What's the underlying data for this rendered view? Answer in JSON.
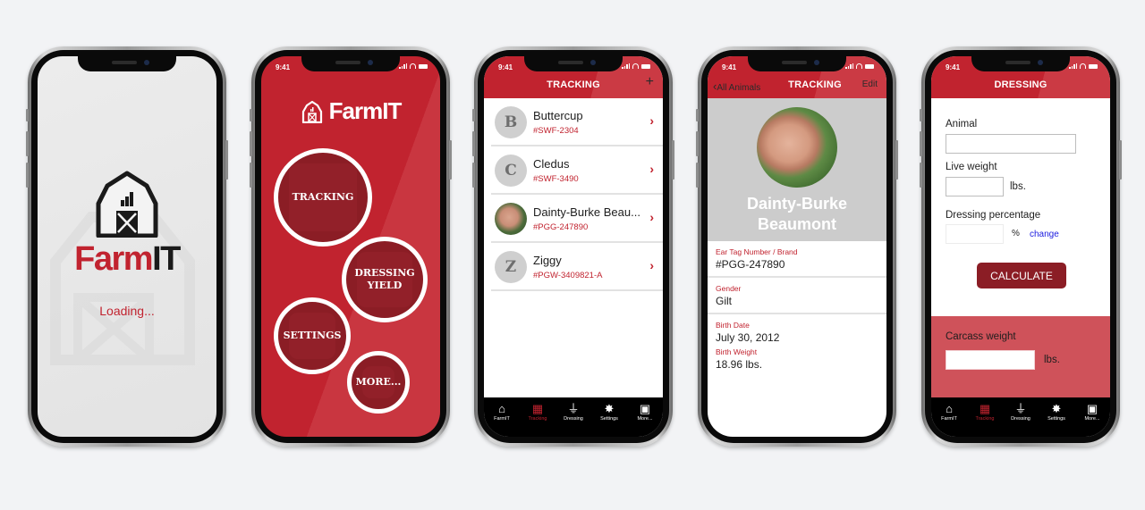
{
  "status_bar": {
    "time": "9:41"
  },
  "colors": {
    "brand_red": "#c1232f",
    "dark_red": "#8b1d25",
    "result_bg": "#cf525a",
    "link_blue": "#1a1adf"
  },
  "splash": {
    "logo": {
      "farm": "Farm",
      "it": "IT"
    },
    "loading_text": "Loading..."
  },
  "home": {
    "logo": {
      "farm": "Farm",
      "it": "IT"
    },
    "buttons": [
      {
        "label": "TRACKING",
        "icon": "notepad-icon"
      },
      {
        "label": "DRESSING YIELD",
        "icon": "scale-icon"
      },
      {
        "label": "SETTINGS",
        "icon": "gear-icon"
      },
      {
        "label": "MORE...",
        "icon": "grid-icon"
      }
    ]
  },
  "tracking_list": {
    "title": "TRACKING",
    "add_icon": "+",
    "animals": [
      {
        "initial": "B",
        "name": "Buttercup",
        "tag": "#SWF-2304",
        "photo": false
      },
      {
        "initial": "C",
        "name": "Cledus",
        "tag": "#SWF-3490",
        "photo": false
      },
      {
        "initial": "",
        "name": "Dainty-Burke Beau...",
        "tag": "#PGG-247890",
        "photo": true
      },
      {
        "initial": "Z",
        "name": "Ziggy",
        "tag": "#PGW-3409821-A",
        "photo": false
      }
    ]
  },
  "tabbar": {
    "items": [
      {
        "label": "FarmIT",
        "icon": "barn-icon",
        "glyph": "⌂"
      },
      {
        "label": "Tracking",
        "icon": "notepad-icon",
        "glyph": "▦"
      },
      {
        "label": "Dressing",
        "icon": "scale-icon",
        "glyph": "⏚"
      },
      {
        "label": "Settings",
        "icon": "gear-icon",
        "glyph": "✸"
      },
      {
        "label": "More...",
        "icon": "grid-icon",
        "glyph": "▣"
      }
    ],
    "active": "Tracking"
  },
  "animal_detail": {
    "back_label": "All Animals",
    "title": "TRACKING",
    "edit_label": "Edit",
    "name_line1": "Dainty-Burke",
    "name_line2": "Beaumont",
    "fields": [
      {
        "label": "Ear Tag Number / Brand",
        "value": "#PGG-247890"
      },
      {
        "label": "Gender",
        "value": "Gilt"
      },
      {
        "label": "Birth Date",
        "value": "July 30, 2012"
      },
      {
        "label": "Birth  Weight",
        "value": "18.96 lbs."
      }
    ]
  },
  "dressing": {
    "title": "DRESSING",
    "animal_label": "Animal",
    "animal_value": "",
    "live_weight_label": "Live weight",
    "live_weight_value": "",
    "live_weight_unit": "lbs.",
    "dressing_pct_label": "Dressing percentage",
    "dressing_pct_value": "",
    "dressing_pct_unit": "%",
    "change_link": "change",
    "calculate_button": "CALCULATE",
    "carcass_label": "Carcass weight",
    "carcass_value": "",
    "carcass_unit": "lbs."
  }
}
